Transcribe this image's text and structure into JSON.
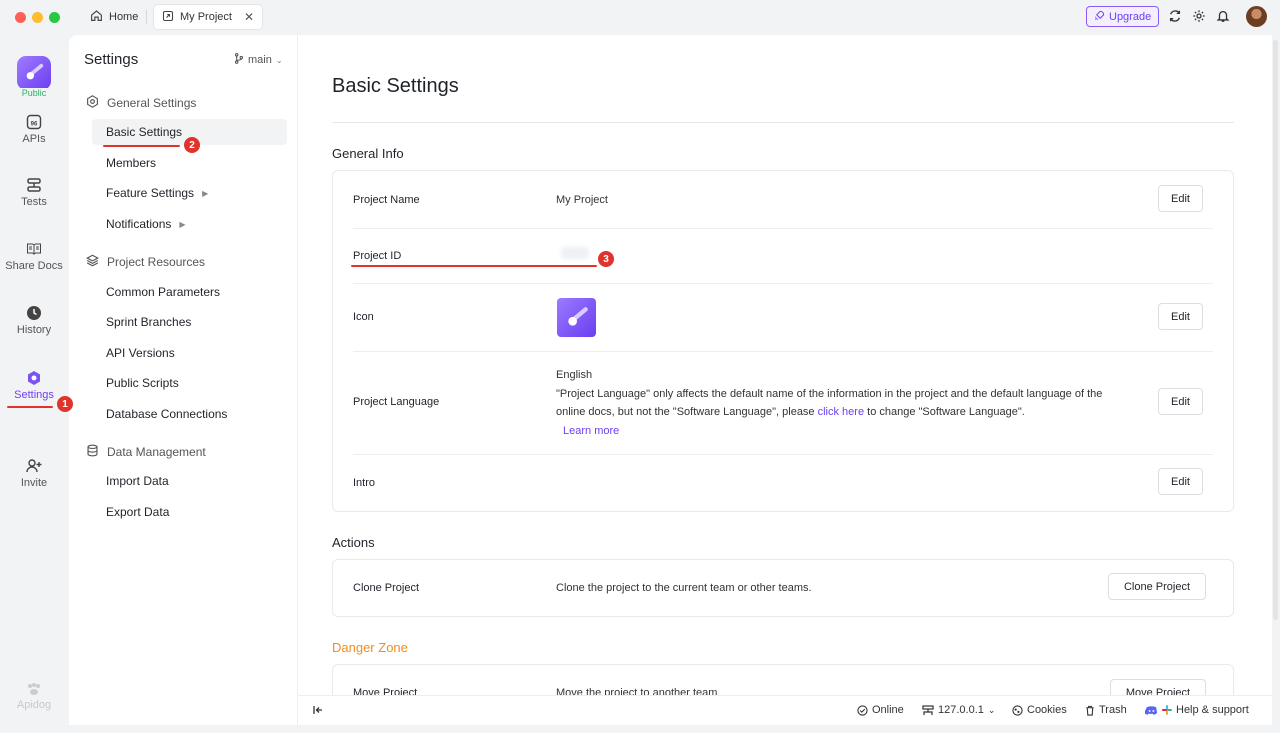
{
  "window": {
    "tabs": [
      {
        "label": "Home"
      },
      {
        "label": "My Project"
      }
    ],
    "upgrade_label": "Upgrade",
    "colors": {
      "accent": "#6e3ff3",
      "danger": "#f08c26",
      "annotation": "#e0332b"
    }
  },
  "rail": {
    "badge": "Public",
    "items": [
      {
        "label": "APIs",
        "icon": "api-icon"
      },
      {
        "label": "Tests",
        "icon": "tests-icon"
      },
      {
        "label": "Share Docs",
        "icon": "book-icon"
      },
      {
        "label": "History",
        "icon": "clock-icon"
      },
      {
        "label": "Settings",
        "icon": "gear-icon"
      },
      {
        "label": "Invite",
        "icon": "add-user-icon"
      }
    ],
    "footer": "Apidog"
  },
  "sidebar": {
    "title": "Settings",
    "branch": "main",
    "groups": [
      {
        "label": "General Settings",
        "items": [
          "Basic Settings",
          "Members",
          "Feature Settings",
          "Notifications"
        ]
      },
      {
        "label": "Project Resources",
        "items": [
          "Common Parameters",
          "Sprint Branches",
          "API Versions",
          "Public Scripts",
          "Database Connections"
        ]
      },
      {
        "label": "Data Management",
        "items": [
          "Import Data",
          "Export Data"
        ]
      }
    ]
  },
  "main": {
    "title": "Basic Settings",
    "general_info": {
      "heading": "General Info",
      "project_name_label": "Project Name",
      "project_name_value": "My Project",
      "project_id_label": "Project ID",
      "icon_label": "Icon",
      "language_label": "Project Language",
      "language_value": "English",
      "language_note_1": "\"Project Language\" only affects the default name of the information in the project and the default language of the online docs, but not the \"Software Language\", please ",
      "language_link": "click here",
      "language_note_2": " to change \"Software Language\".",
      "learn_more": "Learn more",
      "intro_label": "Intro",
      "edit_label": "Edit"
    },
    "actions": {
      "heading": "Actions",
      "clone_label": "Clone Project",
      "clone_desc": "Clone the project to the current team or other teams.",
      "clone_button": "Clone Project"
    },
    "danger": {
      "heading": "Danger Zone",
      "move_label": "Move Project",
      "move_desc": "Move the project to another team.",
      "move_button": "Move Project"
    }
  },
  "statusbar": {
    "online": "Online",
    "host": "127.0.0.1",
    "cookies": "Cookies",
    "trash": "Trash",
    "help": "Help & support"
  },
  "annotations": [
    "1",
    "2",
    "3"
  ]
}
